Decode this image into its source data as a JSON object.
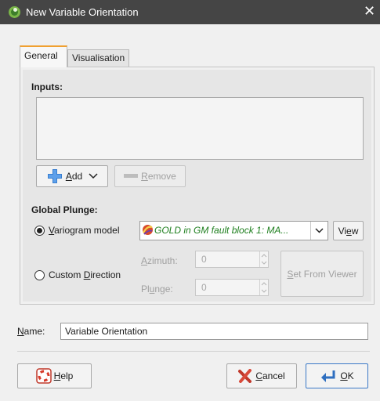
{
  "window": {
    "title": "New Variable Orientation",
    "close_glyph": "✕"
  },
  "tabs": [
    {
      "label": "General",
      "active": true
    },
    {
      "label": "Visualisation",
      "active": false
    }
  ],
  "inputs": {
    "heading": "Inputs:"
  },
  "buttons": {
    "add": {
      "label": "Add",
      "accel": "A",
      "rest": "dd"
    },
    "remove": {
      "label": "Remove",
      "accel": "R",
      "rest": "emove"
    }
  },
  "global_plunge": {
    "heading": "Global Plunge:",
    "variogram_model": {
      "prefix": "",
      "accel": "V",
      "rest": "ariogram model",
      "checked": true
    },
    "combo_value": "GOLD in GM fault block 1: MA...",
    "view_button": {
      "pre": "Vi",
      "accel": "e",
      "post": "w"
    },
    "custom_direction": {
      "pre": "Custom ",
      "accel": "D",
      "rest": "irection",
      "checked": false
    },
    "azimuth": {
      "pre": "",
      "accel": "A",
      "rest": "zimuth:",
      "value": "0"
    },
    "plunge": {
      "pre": "Pl",
      "accel": "u",
      "rest": "nge:",
      "value": "0"
    },
    "set_from_viewer": {
      "accel": "S",
      "rest": "et From Viewer"
    }
  },
  "name_field": {
    "label_accel": "N",
    "label_rest": "ame:",
    "value": "Variable Orientation"
  },
  "footer": {
    "help": {
      "accel": "H",
      "rest": "elp"
    },
    "cancel": {
      "accel": "C",
      "rest": "ancel"
    },
    "ok": {
      "accel": "O",
      "rest": "K"
    }
  },
  "colors": {
    "titlebar": "#454545",
    "active_tab_accent": "#f0a030",
    "combo_text": "#1e7f1e"
  }
}
